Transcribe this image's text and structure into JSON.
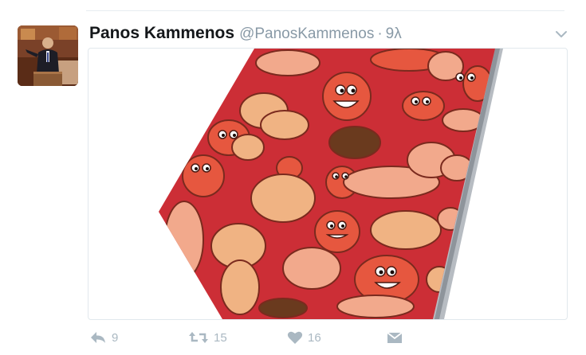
{
  "tweet": {
    "fullname": "Panos Kammenos",
    "username": "@PanosKammenos",
    "separator": "·",
    "timestamp": "9λ",
    "actions": {
      "reply_count": "9",
      "retweet_count": "15",
      "like_count": "16"
    }
  },
  "colors": {
    "name": "#14171a",
    "meta": "#8899a6",
    "action_icon": "#aab8c2",
    "tie_red": "#d0303a",
    "divider": "#e6ecf0"
  },
  "icons": {
    "reply": "reply-icon",
    "retweet": "retweet-icon",
    "like": "heart-icon",
    "message": "envelope-icon",
    "caret": "chevron-down-icon"
  }
}
